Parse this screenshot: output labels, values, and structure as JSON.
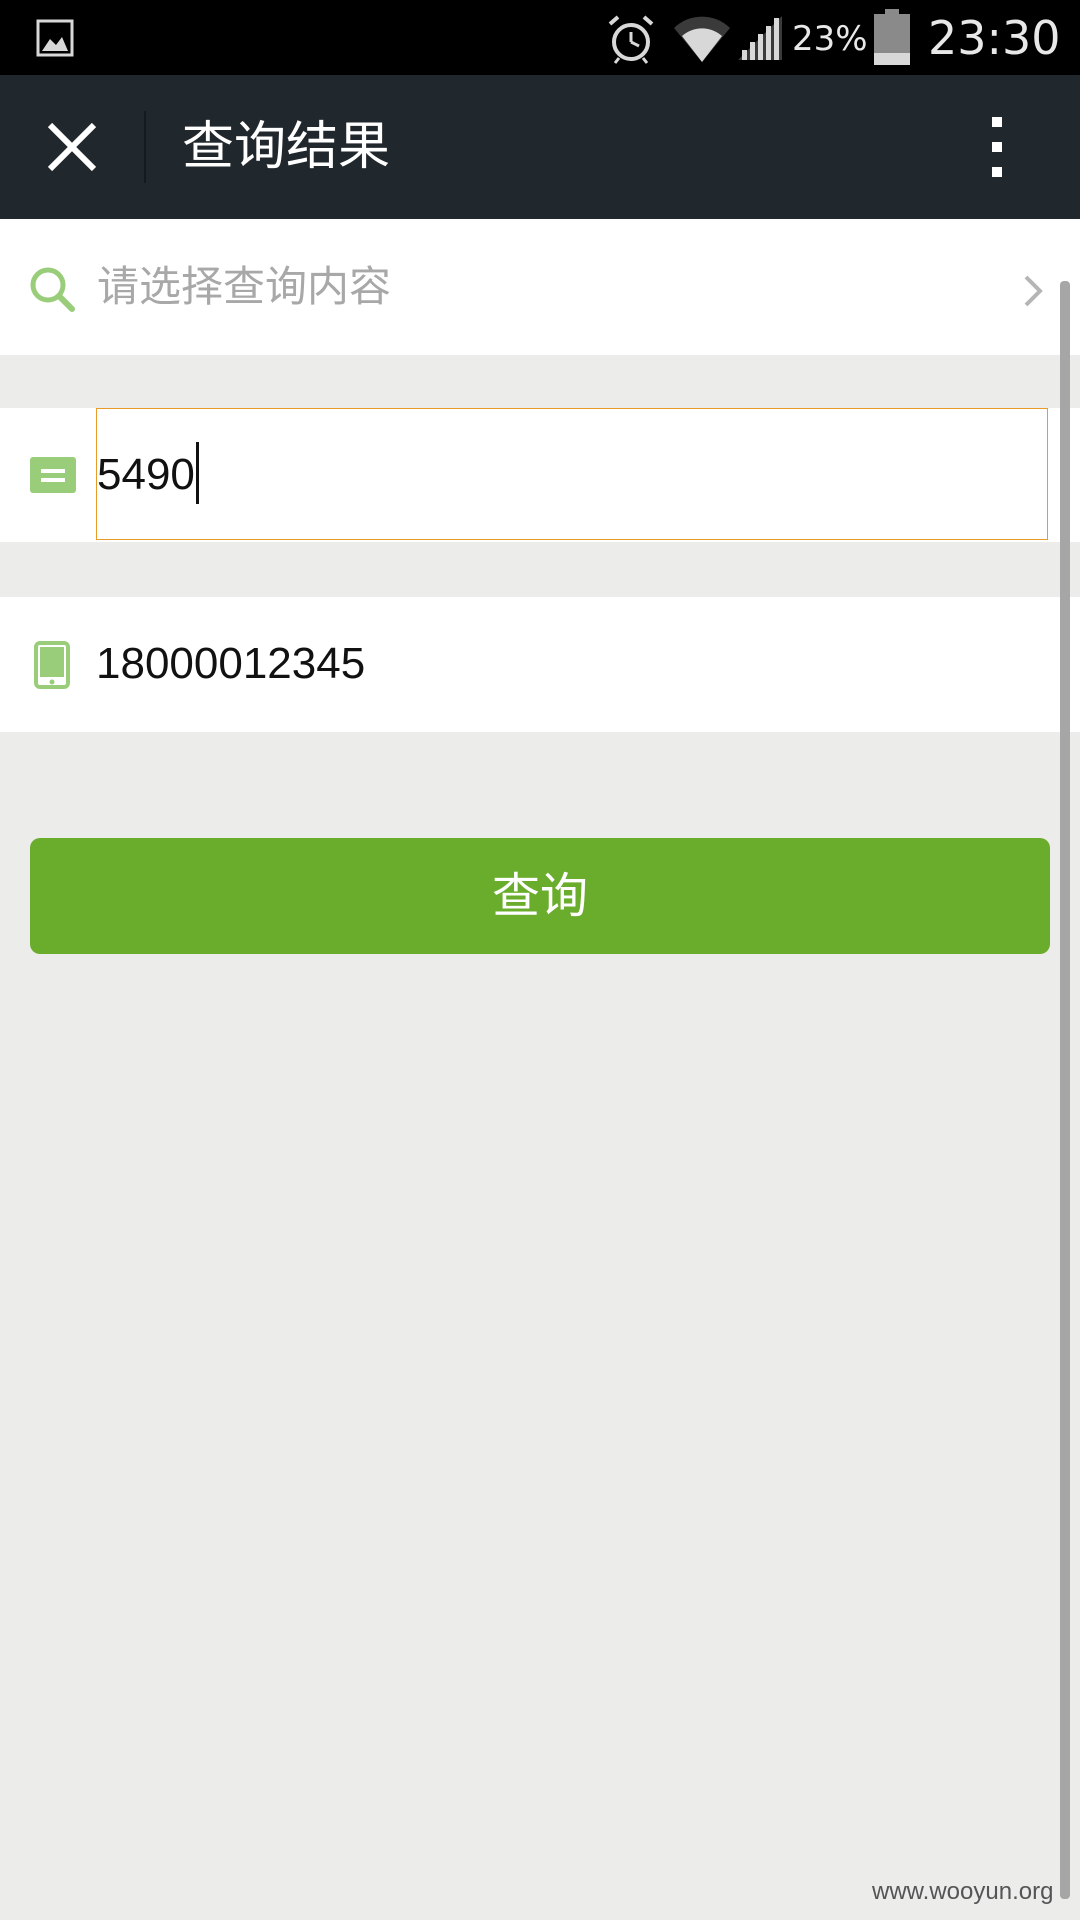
{
  "status_bar": {
    "battery_percent": "23%",
    "time": "23:30",
    "icons": [
      "photo-icon",
      "alarm-icon",
      "wifi-icon",
      "signal-icon",
      "battery-icon"
    ]
  },
  "titlebar": {
    "title": "查询结果",
    "close_icon": "close-icon",
    "more_icon": "more-vertical-icon"
  },
  "form": {
    "search": {
      "placeholder": "请选择查询内容",
      "icon": "search-icon",
      "trailing_icon": "chevron-right-icon"
    },
    "code_field": {
      "value": "5490",
      "icon": "code-card-icon"
    },
    "phone_field": {
      "value": "18000012345",
      "icon": "phone-icon"
    },
    "submit_label": "查询"
  },
  "watermark": "www.wooyun.org",
  "colors": {
    "accent_green": "#6aad2c",
    "icon_green": "#9acd7a",
    "focus_border": "#e89b26",
    "titlebar_bg": "#21282d",
    "page_bg": "#ececeb"
  }
}
